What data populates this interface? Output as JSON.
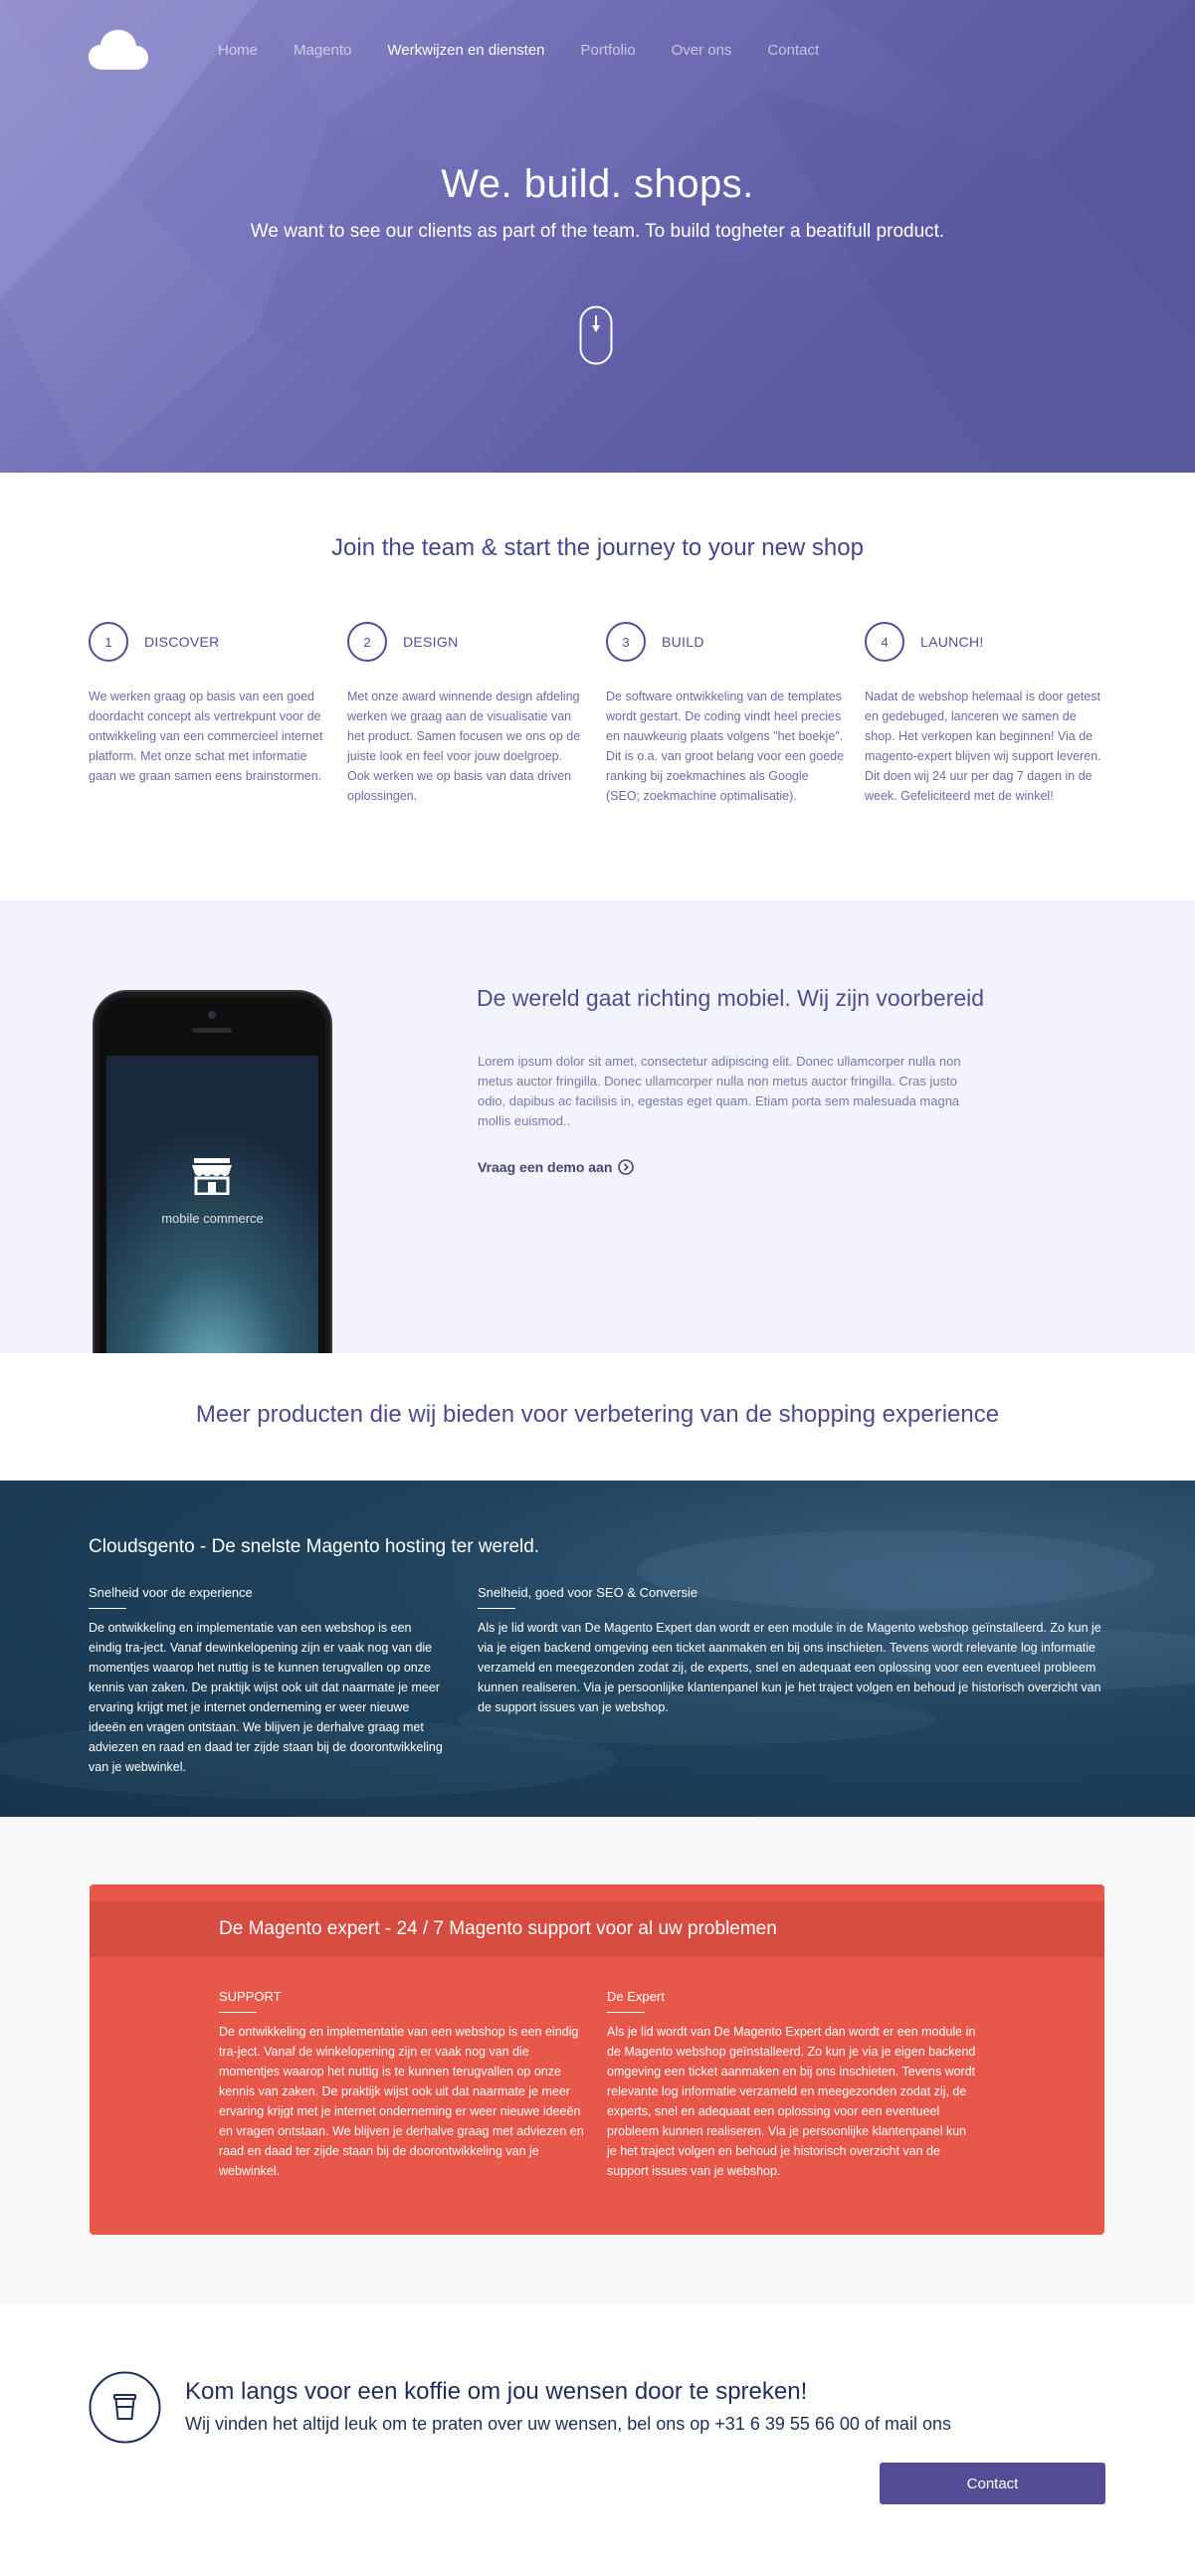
{
  "nav": {
    "logo_icon": "cloud-icon",
    "items": [
      {
        "label": "Home",
        "active": false
      },
      {
        "label": "Magento",
        "active": false
      },
      {
        "label": "Werkwijzen en diensten",
        "active": true
      },
      {
        "label": "Portfolio",
        "active": false
      },
      {
        "label": "Over ons",
        "active": false
      },
      {
        "label": "Contact",
        "active": false
      }
    ]
  },
  "hero": {
    "title": "We. build. shops.",
    "subtitle": "We want to see our clients as part of the team. To build togheter a beatifull product.",
    "scroll_icon": "mouse-scroll-icon"
  },
  "journey": {
    "title": "Join the team & start the journey to your new shop",
    "steps": [
      {
        "number": "1",
        "name": "DISCOVER",
        "text": "We werken graag op basis van een goed doordacht concept als vertrekpunt voor de ontwikkeling van een commercieel internet platform. Met onze schat met informatie gaan we graan samen eens brainstormen."
      },
      {
        "number": "2",
        "name": "DESIGN",
        "text": "Met onze award winnende design afdeling werken we graag aan de visualisatie van het product. Samen focusen we ons op de juiste look en feel voor jouw doelgroep. Ook werken we op basis van data driven oplossingen."
      },
      {
        "number": "3",
        "name": "BUILD",
        "text": "De software ontwikkeling van de templates wordt gestart. De coding vindt heel precies en nauwkeurig plaats volgens \"het boekje\". Dit is o.a. van groot belang voor een goede ranking bij zoekmachines als Google (SEO; zoekmachine optimalisatie)."
      },
      {
        "number": "4",
        "name": "LAUNCH!",
        "text": "Nadat de webshop helemaal is door getest en gedebuged, lanceren we samen de shop. Het verkopen kan beginnen! Via de magento-expert blijven wij support leveren. Dit doen wij 24 uur per dag 7 dagen in de week. Gefeliciteerd met de winkel!"
      }
    ]
  },
  "mobile": {
    "phone_caption": "mobile commerce",
    "phone_icon": "storefront-icon",
    "title": "De wereld gaat richting mobiel. Wij zijn voorbereid",
    "text": "Lorem ipsum dolor sit amet, consectetur adipiscing elit. Donec ullamcorper nulla non metus auctor fringilla. Donec ullamcorper nulla non metus auctor fringilla. Cras justo odio, dapibus ac facilisis in, egestas eget quam. Etiam porta sem malesuada magna mollis euismod..",
    "link_label": "Vraag een demo aan",
    "link_icon": "circle-chevron-right-icon"
  },
  "more": {
    "title": "Meer producten die wij bieden voor verbetering van de shopping experience"
  },
  "hosting": {
    "title": "Cloudsgento - De snelste Magento hosting ter wereld.",
    "columns": [
      {
        "heading": "Snelheid voor de experience",
        "text": "De ontwikkeling en implementatie van een webshop is een eindig tra-ject. Vanaf dewinkelopening zijn er vaak nog van die momentjes waarop het nuttig is te kunnen terugvallen op onze kennis van zaken. De praktijk wijst ook uit dat naarmate je meer ervaring krijgt met je internet onderneming er weer nieuwe ideeën en vragen ontstaan. We blijven je derhalve graag met adviezen en raad en daad ter zijde staan bij de doorontwikkeling van je webwinkel."
      },
      {
        "heading": "Snelheid, goed voor SEO & Conversie",
        "text": "Als je lid wordt van De Magento Expert dan wordt er een module in de Magento webshop geïnstalleerd. Zo kun je via je eigen backend omgeving een ticket aanmaken en bij ons inschieten. Tevens wordt relevante log informatie verzameld en meegezonden zodat zij, de experts, snel en adequaat een oplossing voor een eventueel probleem kunnen realiseren. Via je persoonlijke klantenpanel kun je het traject volgen en behoud je historisch overzicht van de support issues van je webshop."
      }
    ]
  },
  "support": {
    "title": "De Magento expert - 24 / 7 Magento support voor al uw problemen",
    "columns": [
      {
        "heading": "SUPPORT",
        "text": "De ontwikkeling en implementatie van een webshop is een eindig tra-ject. Vanaf de winkelopening zijn er vaak nog van die momentjes waarop het nuttig is te kunnen terugvallen op onze kennis van zaken. De praktijk wijst ook uit dat naarmate je meer ervaring krijgt met je internet onderneming er weer nieuwe ideeën en vragen ontstaan. We blijven je derhalve graag met adviezen en raad en daad ter zijde staan bij de doorontwikkeling van je webwinkel."
      },
      {
        "heading": "De Expert",
        "text": "Als je lid wordt van De Magento Expert dan wordt er een module in de Magento webshop geïnstalleerd. Zo kun je via je eigen backend omgeving een ticket aanmaken en bij ons inschieten. Tevens wordt relevante log informatie verzameld en meegezonden zodat zij, de experts, snel en adequaat een oplossing voor een eventueel probleem kunnen realiseren. Via je persoonlijke klantenpanel kun je het traject volgen en behoud je historisch overzicht van de support issues van je webshop."
      }
    ]
  },
  "coffee": {
    "icon": "coffee-cup-icon",
    "title": "Kom langs voor een koffie om jou wensen door te spreken!",
    "subtitle": "Wij vinden het altijd leuk om te praten over uw wensen, bel ons op +31 6 39 55 66 00  of mail ons",
    "button_label": "Contact"
  },
  "colors": {
    "hero_purple": "#6f6db5",
    "text_purple": "#4f4f96",
    "mobile_bg": "#f3f3fd",
    "hosting_blue": "#21445f",
    "support_red": "#e8584a",
    "button_purple": "#544c94"
  }
}
